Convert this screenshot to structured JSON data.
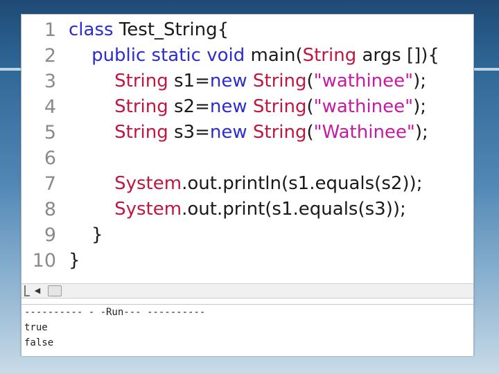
{
  "editor": {
    "line_numbers": [
      "1",
      "2",
      "3",
      "4",
      "5",
      "6",
      "7",
      "8",
      "9",
      "10"
    ],
    "lines": [
      [
        {
          "t": "class",
          "c": "kw"
        },
        {
          "t": " Test_String{",
          "c": ""
        }
      ],
      [
        {
          "t": "    ",
          "c": ""
        },
        {
          "t": "public static void",
          "c": "kw"
        },
        {
          "t": " main(",
          "c": ""
        },
        {
          "t": "String",
          "c": "ty"
        },
        {
          "t": " args []){",
          "c": ""
        }
      ],
      [
        {
          "t": "        ",
          "c": ""
        },
        {
          "t": "String",
          "c": "ty"
        },
        {
          "t": " s1=",
          "c": ""
        },
        {
          "t": "new",
          "c": "kw"
        },
        {
          "t": " ",
          "c": ""
        },
        {
          "t": "String",
          "c": "ty"
        },
        {
          "t": "(",
          "c": ""
        },
        {
          "t": "\"wathinee\"",
          "c": "st"
        },
        {
          "t": ");",
          "c": ""
        }
      ],
      [
        {
          "t": "        ",
          "c": ""
        },
        {
          "t": "String",
          "c": "ty"
        },
        {
          "t": " s2=",
          "c": ""
        },
        {
          "t": "new",
          "c": "kw"
        },
        {
          "t": " ",
          "c": ""
        },
        {
          "t": "String",
          "c": "ty"
        },
        {
          "t": "(",
          "c": ""
        },
        {
          "t": "\"wathinee\"",
          "c": "st"
        },
        {
          "t": ");",
          "c": ""
        }
      ],
      [
        {
          "t": "        ",
          "c": ""
        },
        {
          "t": "String",
          "c": "ty"
        },
        {
          "t": " s3=",
          "c": ""
        },
        {
          "t": "new",
          "c": "kw"
        },
        {
          "t": " ",
          "c": ""
        },
        {
          "t": "String",
          "c": "ty"
        },
        {
          "t": "(",
          "c": ""
        },
        {
          "t": "\"Wathinee\"",
          "c": "st"
        },
        {
          "t": ");",
          "c": ""
        }
      ],
      [
        {
          "t": "",
          "c": ""
        }
      ],
      [
        {
          "t": "        ",
          "c": ""
        },
        {
          "t": "System",
          "c": "ty"
        },
        {
          "t": ".out.println(s1.equals(s2));",
          "c": ""
        }
      ],
      [
        {
          "t": "        ",
          "c": ""
        },
        {
          "t": "System",
          "c": "ty"
        },
        {
          "t": ".out.print(s1.equals(s3));",
          "c": ""
        }
      ],
      [
        {
          "t": "    }",
          "c": ""
        }
      ],
      [
        {
          "t": "}",
          "c": ""
        }
      ]
    ],
    "colors": {
      "keyword": "#2c2ccf",
      "type": "#c0163f",
      "string": "#c71aa0",
      "text": "#1a1a1a",
      "line_number": "#8a8a8a"
    }
  },
  "scrollbar": {
    "left_arrow_icon": "triangle-left-icon"
  },
  "output": {
    "header": "---------- - -Run--- ----------",
    "lines": [
      "true",
      "false"
    ]
  }
}
